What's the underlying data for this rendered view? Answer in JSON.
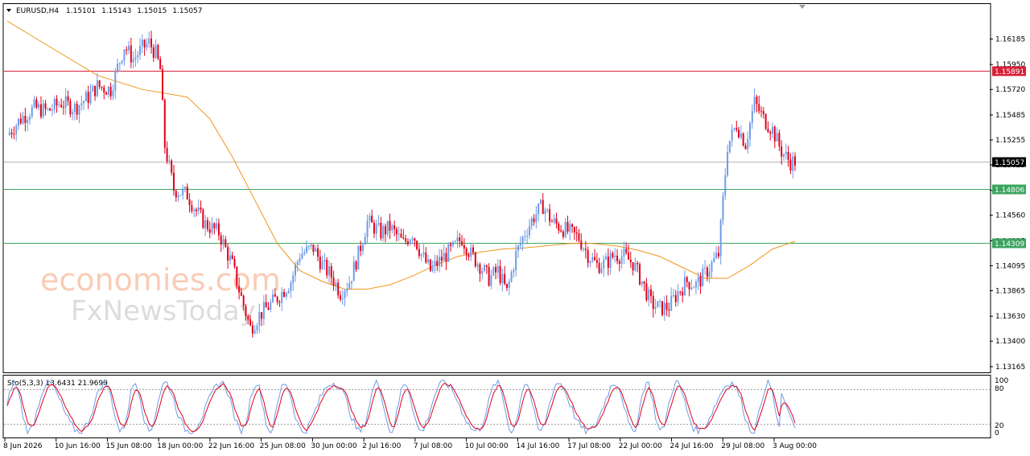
{
  "header": {
    "symbol": "EURUSD,H4",
    "open": "1.15101",
    "high": "1.15143",
    "low": "1.15015",
    "close": "1.15057"
  },
  "indicator": {
    "label": "Sto(5,3,3) 13.6431 21.9699",
    "levels": [
      "100",
      "80",
      "20",
      "0"
    ]
  },
  "watermark": {
    "line1": "economies.com",
    "line2": "FxNewsToday"
  },
  "colors": {
    "bull": "#6f9be6",
    "bear": "#e2001a",
    "ma": "#f0961e",
    "resistance": "#d8203a",
    "support": "#3ba45f",
    "current": "#000000",
    "stoch_main": "#6f9be6",
    "stoch_signal": "#e2001a"
  },
  "chart_data": {
    "type": "candlestick",
    "symbol": "EURUSD",
    "timeframe": "H4",
    "price_ticks": [
      "1.16185",
      "1.15950",
      "1.15720",
      "1.15485",
      "1.15255",
      "1.15025",
      "1.14790",
      "1.14560",
      "1.14325",
      "1.14095",
      "1.13865",
      "1.13630",
      "1.13400",
      "1.13165"
    ],
    "y_range": [
      1.1312,
      1.165
    ],
    "date_ticks": [
      "8 Jun 2026",
      "10 Jun 16:00",
      "15 Jun 08:00",
      "18 Jun 00:00",
      "22 Jun 16:00",
      "25 Jun 08:00",
      "30 Jun 00:00",
      "2 Jul 16:00",
      "7 Jul 08:00",
      "10 Jul 00:00",
      "14 Jul 16:00",
      "17 Jul 08:00",
      "22 Jul 00:00",
      "24 Jul 16:00",
      "29 Jul 08:00",
      "3 Aug 00:00"
    ],
    "horizontal_levels": [
      {
        "value": 1.15891,
        "label": "1.15891",
        "role": "resistance"
      },
      {
        "value": 1.15057,
        "label": "1.15057",
        "role": "current"
      },
      {
        "value": 1.14806,
        "label": "1.14806",
        "role": "support"
      },
      {
        "value": 1.14309,
        "label": "1.14309",
        "role": "support"
      }
    ],
    "close_path": [
      [
        0,
        1.153
      ],
      [
        6,
        1.1545
      ],
      [
        12,
        1.1555
      ],
      [
        18,
        1.1552
      ],
      [
        24,
        1.156
      ],
      [
        30,
        1.1555
      ],
      [
        36,
        1.1565
      ],
      [
        40,
        1.1575
      ],
      [
        46,
        1.1572
      ],
      [
        52,
        1.1612
      ],
      [
        56,
        1.16
      ],
      [
        60,
        1.161
      ],
      [
        63,
        1.1615
      ],
      [
        66,
        1.1605
      ],
      [
        68,
        1.159
      ],
      [
        70,
        1.152
      ],
      [
        74,
        1.148
      ],
      [
        80,
        1.1475
      ],
      [
        84,
        1.146
      ],
      [
        88,
        1.1448
      ],
      [
        94,
        1.144
      ],
      [
        100,
        1.141
      ],
      [
        104,
        1.138
      ],
      [
        108,
        1.1352
      ],
      [
        112,
        1.1364
      ],
      [
        116,
        1.1372
      ],
      [
        120,
        1.138
      ],
      [
        126,
        1.1395
      ],
      [
        130,
        1.142
      ],
      [
        136,
        1.1426
      ],
      [
        140,
        1.141
      ],
      [
        144,
        1.14
      ],
      [
        148,
        1.1385
      ],
      [
        152,
        1.1395
      ],
      [
        156,
        1.142
      ],
      [
        160,
        1.145
      ],
      [
        166,
        1.144
      ],
      [
        170,
        1.1445
      ],
      [
        176,
        1.143
      ],
      [
        180,
        1.144
      ],
      [
        184,
        1.142
      ],
      [
        188,
        1.1405
      ],
      [
        194,
        1.1418
      ],
      [
        198,
        1.1425
      ],
      [
        202,
        1.1435
      ],
      [
        206,
        1.142
      ],
      [
        210,
        1.141
      ],
      [
        214,
        1.1398
      ],
      [
        218,
        1.1405
      ],
      [
        222,
        1.1385
      ],
      [
        226,
        1.142
      ],
      [
        230,
        1.144
      ],
      [
        234,
        1.1455
      ],
      [
        238,
        1.1465
      ],
      [
        242,
        1.145
      ],
      [
        246,
        1.1445
      ],
      [
        250,
        1.144
      ],
      [
        254,
        1.1435
      ],
      [
        258,
        1.142
      ],
      [
        262,
        1.141
      ],
      [
        266,
        1.1412
      ],
      [
        270,
        1.142
      ],
      [
        274,
        1.1418
      ],
      [
        278,
        1.1412
      ],
      [
        282,
        1.1395
      ],
      [
        286,
        1.1375
      ],
      [
        290,
        1.137
      ],
      [
        294,
        1.1372
      ],
      [
        298,
        1.1385
      ],
      [
        302,
        1.1395
      ],
      [
        306,
        1.1392
      ],
      [
        310,
        1.1402
      ],
      [
        316,
        1.142
      ],
      [
        320,
        1.152
      ],
      [
        324,
        1.154
      ],
      [
        328,
        1.1522
      ],
      [
        332,
        1.156
      ],
      [
        336,
        1.1545
      ],
      [
        340,
        1.1535
      ],
      [
        344,
        1.1515
      ],
      [
        348,
        1.1505
      ],
      [
        350,
        1.1506
      ]
    ],
    "moving_average": [
      [
        0,
        1.1635
      ],
      [
        20,
        1.161
      ],
      [
        40,
        1.1585
      ],
      [
        60,
        1.1572
      ],
      [
        80,
        1.1565
      ],
      [
        90,
        1.1545
      ],
      [
        100,
        1.151
      ],
      [
        110,
        1.147
      ],
      [
        120,
        1.143
      ],
      [
        130,
        1.1405
      ],
      [
        140,
        1.1395
      ],
      [
        150,
        1.1388
      ],
      [
        160,
        1.1388
      ],
      [
        170,
        1.1392
      ],
      [
        180,
        1.14
      ],
      [
        190,
        1.141
      ],
      [
        200,
        1.1418
      ],
      [
        210,
        1.1422
      ],
      [
        220,
        1.1425
      ],
      [
        230,
        1.1426
      ],
      [
        240,
        1.1428
      ],
      [
        250,
        1.143
      ],
      [
        260,
        1.143
      ],
      [
        270,
        1.1428
      ],
      [
        280,
        1.1424
      ],
      [
        290,
        1.1418
      ],
      [
        300,
        1.1408
      ],
      [
        310,
        1.1398
      ],
      [
        320,
        1.1398
      ],
      [
        330,
        1.141
      ],
      [
        340,
        1.1425
      ],
      [
        350,
        1.1432
      ]
    ],
    "stochastic": {
      "label": "Sto(5,3,3)",
      "main": 13.6431,
      "signal": 21.9699,
      "levels": [
        100,
        80,
        20,
        0
      ],
      "y_range": [
        0,
        100
      ]
    }
  }
}
